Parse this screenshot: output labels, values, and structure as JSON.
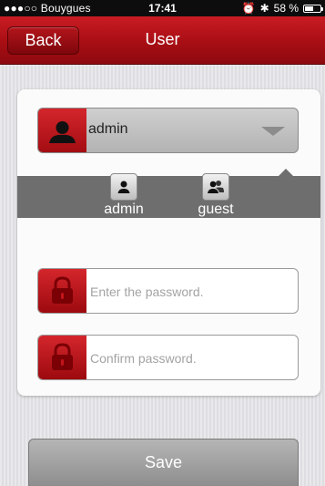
{
  "status_bar": {
    "carrier": "●●●○○ Bouygues",
    "time": "17:41",
    "battery": "58 %",
    "battery_level": 0.58
  },
  "nav": {
    "back_label": "Back",
    "title": "User"
  },
  "user_select": {
    "selected": "admin",
    "options": [
      {
        "label": "admin",
        "icon": "user-icon"
      },
      {
        "label": "guest",
        "icon": "users-icon"
      }
    ]
  },
  "password": {
    "placeholder": "Enter the password.",
    "value": ""
  },
  "confirm": {
    "placeholder": "Confirm password.",
    "value": ""
  },
  "save_label": "Save",
  "colors": {
    "brand_red": "#b3151b",
    "panel_gray": "#6e6e6e",
    "button_gray": "#a3a3a3"
  }
}
